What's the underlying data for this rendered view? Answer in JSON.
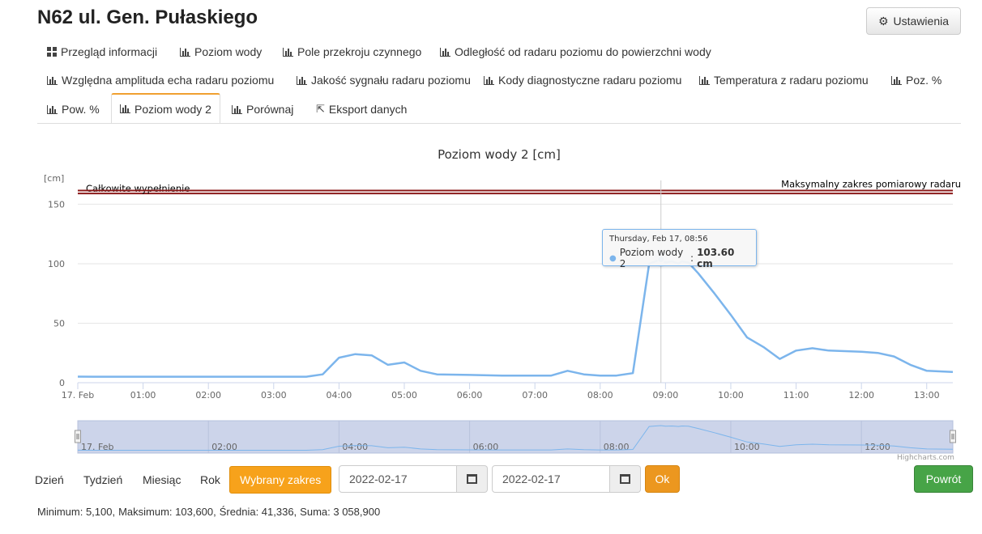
{
  "page": {
    "title": "N62 ul. Gen. Pułaskiego"
  },
  "header": {
    "settings_label": "Ustawienia",
    "settings_icon": "gear-icon"
  },
  "tabs": [
    {
      "label": "Przegląd informacji",
      "icon": "grid-icon"
    },
    {
      "label": "Poziom wody",
      "icon": "bar-chart-icon"
    },
    {
      "label": "Pole przekroju czynnego",
      "icon": "bar-chart-icon"
    },
    {
      "label": "Odległość od radaru poziomu do powierzchni wody",
      "icon": "bar-chart-icon"
    },
    {
      "label": "Względna amplituda echa radaru poziomu",
      "icon": "bar-chart-icon"
    },
    {
      "label": "Jakość sygnału radaru poziomu",
      "icon": "bar-chart-icon"
    },
    {
      "label": "Kody diagnostyczne radaru poziomu",
      "icon": "bar-chart-icon"
    },
    {
      "label": "Temperatura z radaru poziomu",
      "icon": "bar-chart-icon"
    },
    {
      "label": "Poz. %",
      "icon": "bar-chart-icon"
    },
    {
      "label": "Pow. %",
      "icon": "bar-chart-icon"
    },
    {
      "label": "Poziom wody 2",
      "icon": "bar-chart-icon",
      "active": true
    },
    {
      "label": "Porównaj",
      "icon": "bar-chart-icon"
    },
    {
      "label": "Eksport danych",
      "icon": "export-icon"
    }
  ],
  "chart_data": {
    "type": "line",
    "title": "Poziom wody 2 [cm]",
    "ylabel": "[cm]",
    "ylim": [
      0,
      170
    ],
    "yticks": [
      0,
      50,
      100,
      150
    ],
    "xticks": [
      "17. Feb",
      "01:00",
      "02:00",
      "03:00",
      "04:00",
      "05:00",
      "06:00",
      "07:00",
      "08:00",
      "09:00",
      "10:00",
      "11:00",
      "12:00",
      "13:00"
    ],
    "x_range_hours": [
      0,
      13.4
    ],
    "grid": true,
    "series": [
      {
        "name": "Poziom wody 2",
        "color": "#7cb5ec",
        "x": [
          0,
          0.25,
          1,
          2,
          3,
          3.5,
          3.75,
          4,
          4.25,
          4.5,
          4.75,
          5,
          5.25,
          5.5,
          6,
          6.5,
          7,
          7.25,
          7.5,
          7.75,
          8,
          8.25,
          8.5,
          8.75,
          8.93,
          9.0,
          9.1,
          9.2,
          9.25,
          9.35,
          9.5,
          9.75,
          10,
          10.25,
          10.5,
          10.75,
          11,
          11.25,
          11.5,
          12,
          12.25,
          12.5,
          12.75,
          13,
          13.4
        ],
        "y": [
          5.1,
          5,
          5,
          5,
          5,
          5,
          7,
          21,
          24,
          23,
          15,
          17,
          10,
          7,
          6.5,
          6,
          6,
          6,
          10,
          7,
          6,
          6,
          8,
          100,
          103.6,
          101,
          102,
          100,
          102,
          101,
          92,
          75,
          57,
          38,
          30,
          20,
          27,
          29,
          27,
          26,
          25,
          22,
          15,
          10,
          9
        ]
      }
    ],
    "plot_lines": [
      {
        "label": "Całkowite wypełnienie",
        "value": 159,
        "color": "#8b1a1a"
      },
      {
        "label": "Maksymalny zakres pomiarowy radaru",
        "value": 161.5,
        "color": "#8b1a1a"
      }
    ],
    "navigator_ticks": [
      "17. Feb",
      "02:00",
      "04:00",
      "06:00",
      "08:00",
      "10:00",
      "12:00"
    ],
    "credit": "Highcharts.com"
  },
  "tooltip": {
    "date": "Thursday, Feb 17, 08:56",
    "series": "Poziom wody 2",
    "value": "103.60 cm",
    "x_hours": 8.93
  },
  "range": {
    "buttons": [
      "Dzień",
      "Tydzień",
      "Miesiąc",
      "Rok"
    ],
    "selected_label": "Wybrany zakres",
    "from": "2022-02-17",
    "to": "2022-02-17",
    "ok_label": "Ok"
  },
  "back_label": "Powrót",
  "stats": {
    "min": "Minimum: 5,100,",
    "max": "Maksimum: 103,600,",
    "avg": "Średnia: 41,336,",
    "sum": "Suma: 3 058,900"
  }
}
